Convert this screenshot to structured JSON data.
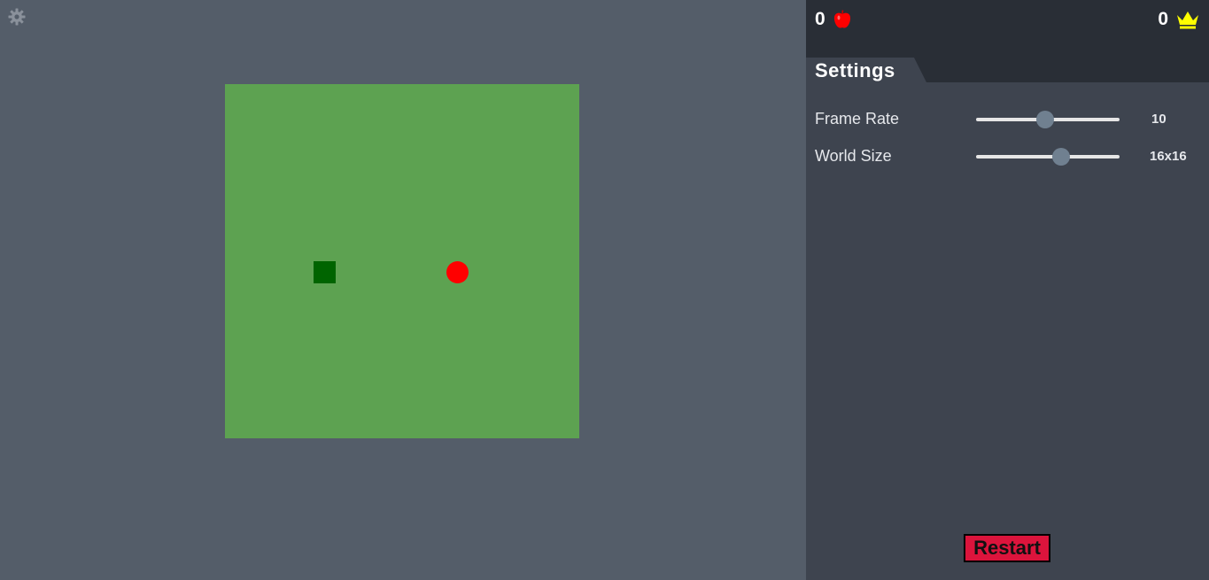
{
  "settings_icon": "gear-icon",
  "game": {
    "grid_cells": 16,
    "snake": {
      "cell": [
        4,
        8
      ],
      "color": "#006400"
    },
    "food": {
      "cell": [
        10,
        8
      ],
      "color": "#ff0000"
    },
    "board_color": "#5da251"
  },
  "panel": {
    "score": {
      "value": "0",
      "icon": "apple-icon"
    },
    "high_score": {
      "value": "0",
      "icon": "crown-icon"
    },
    "tab_label": "Settings",
    "settings": [
      {
        "label": "Frame Rate",
        "value": "10",
        "slider_fraction": 0.48
      },
      {
        "label": "World Size",
        "value": "16x16",
        "slider_fraction": 0.59
      }
    ],
    "restart_label": "Restart"
  },
  "colors": {
    "background": "#545d69",
    "panel": "#3e444f",
    "topbar": "#292e36",
    "restart": "#dc143c",
    "slider_thumb": "#708090",
    "crown": "#ffff00"
  }
}
